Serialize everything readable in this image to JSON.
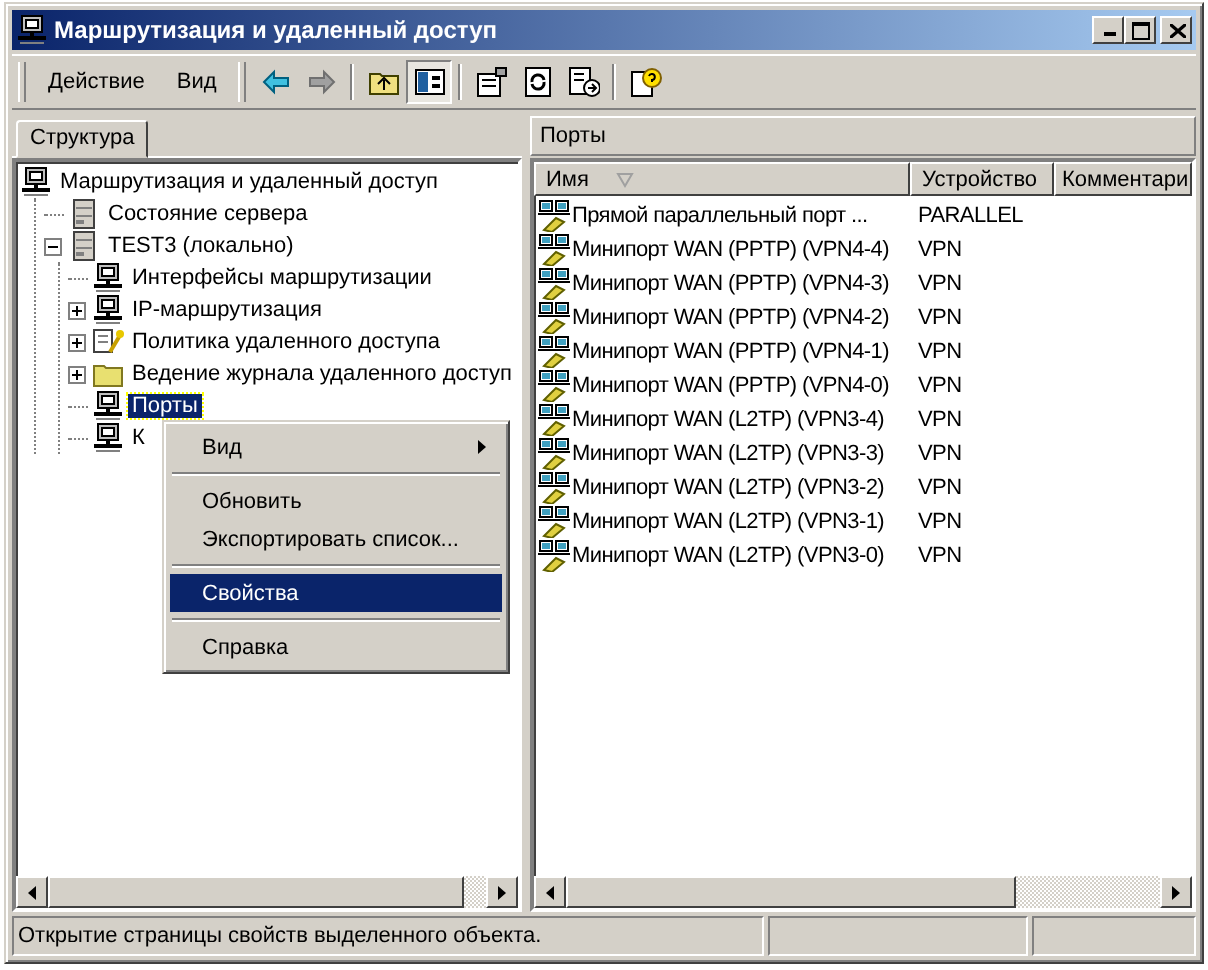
{
  "window": {
    "title": "Маршрутизация и удаленный доступ"
  },
  "menubar": [
    {
      "label": "Действие"
    },
    {
      "label": "Вид"
    }
  ],
  "toolbar": [
    {
      "kind": "back",
      "pressed": false
    },
    {
      "kind": "forward",
      "pressed": false
    },
    {
      "kind": "sep"
    },
    {
      "kind": "up",
      "pressed": false
    },
    {
      "kind": "tree",
      "pressed": true
    },
    {
      "kind": "sep"
    },
    {
      "kind": "properties",
      "pressed": false
    },
    {
      "kind": "refresh",
      "pressed": false
    },
    {
      "kind": "export",
      "pressed": false
    },
    {
      "kind": "sep"
    },
    {
      "kind": "help",
      "pressed": false
    }
  ],
  "left_pane": {
    "tabs": [
      {
        "label": "Структура",
        "selected": true
      }
    ],
    "tree": [
      {
        "label": "Маршрутизация и удаленный доступ",
        "kind": "computer",
        "selected": false,
        "children": [
          {
            "label": "Состояние сервера",
            "kind": "server",
            "selected": false
          },
          {
            "label": "TEST3 (локально)",
            "kind": "server",
            "selected": false,
            "expanded": true,
            "children": [
              {
                "label": "Интерфейсы маршрутизации",
                "kind": "computer",
                "selected": false
              },
              {
                "label": "IP-маршрутизация",
                "kind": "computer",
                "selected": false,
                "expanded": false
              },
              {
                "label": "Политика удаленного доступа",
                "kind": "policy",
                "selected": false,
                "expanded": false
              },
              {
                "label": "Ведение журнала удаленного доступ",
                "kind": "folder",
                "selected": false,
                "expanded": false
              },
              {
                "label": "Порты",
                "kind": "computer",
                "selected": true
              },
              {
                "label": "К",
                "kind": "computer",
                "selected": false
              }
            ]
          }
        ]
      }
    ]
  },
  "right_pane": {
    "title": "Порты",
    "columns": [
      {
        "label": "Имя",
        "sorted": true
      },
      {
        "label": "Устройство"
      },
      {
        "label": "Комментари"
      }
    ],
    "rows": [
      {
        "name": "Прямой параллельный порт ...",
        "device": "PARALLEL"
      },
      {
        "name": "Минипорт WAN (PPTP) (VPN4-4)",
        "device": "VPN"
      },
      {
        "name": "Минипорт WAN (PPTP) (VPN4-3)",
        "device": "VPN"
      },
      {
        "name": "Минипорт WAN (PPTP) (VPN4-2)",
        "device": "VPN"
      },
      {
        "name": "Минипорт WAN (PPTP) (VPN4-1)",
        "device": "VPN"
      },
      {
        "name": "Минипорт WAN (PPTP) (VPN4-0)",
        "device": "VPN"
      },
      {
        "name": "Минипорт WAN (L2TP) (VPN3-4)",
        "device": "VPN"
      },
      {
        "name": "Минипорт WAN (L2TP) (VPN3-3)",
        "device": "VPN"
      },
      {
        "name": "Минипорт WAN (L2TP) (VPN3-2)",
        "device": "VPN"
      },
      {
        "name": "Минипорт WAN (L2TP) (VPN3-1)",
        "device": "VPN"
      },
      {
        "name": "Минипорт WAN (L2TP) (VPN3-0)",
        "device": "VPN"
      }
    ]
  },
  "context_menu": [
    {
      "kind": "item",
      "label": "Вид",
      "submenu": true,
      "selected": false
    },
    {
      "kind": "separator"
    },
    {
      "kind": "item",
      "label": "Обновить",
      "submenu": false,
      "selected": false
    },
    {
      "kind": "item",
      "label": "Экспортировать список...",
      "submenu": false,
      "selected": false
    },
    {
      "kind": "separator"
    },
    {
      "kind": "item",
      "label": "Свойства",
      "submenu": false,
      "selected": true
    },
    {
      "kind": "separator"
    },
    {
      "kind": "item",
      "label": "Справка",
      "submenu": false,
      "selected": false
    }
  ],
  "status_bar": {
    "text": "Открытие страницы свойств выделенного объекта."
  }
}
